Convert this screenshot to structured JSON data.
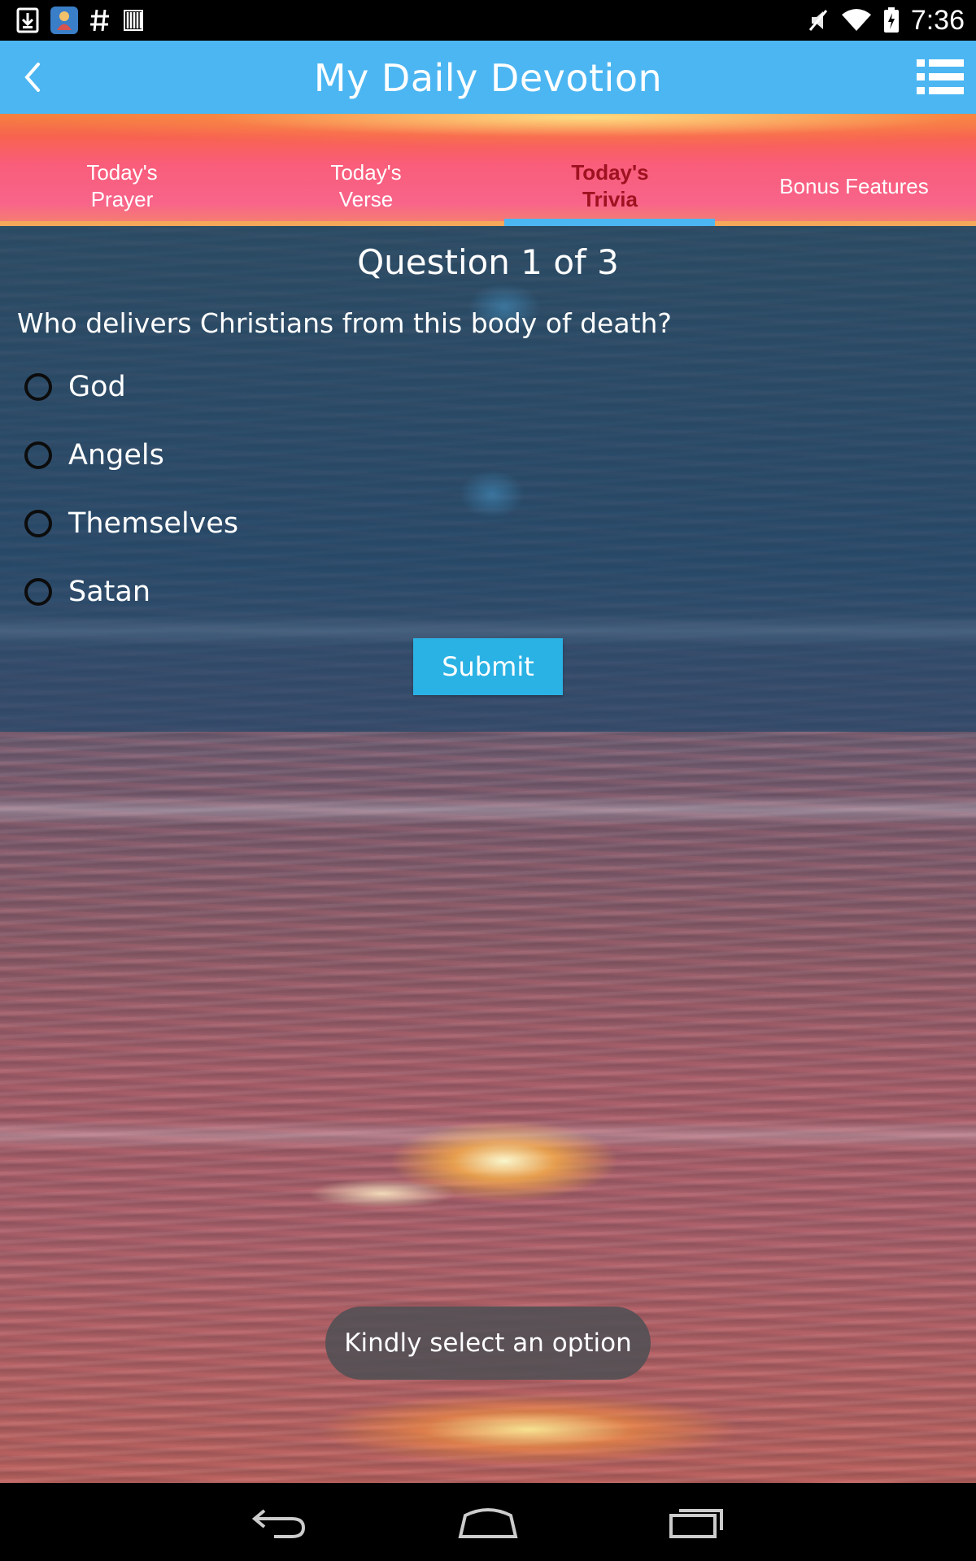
{
  "status_bar": {
    "time": "7:36",
    "left_icons": [
      "download-icon",
      "app-icon",
      "hashtag-icon",
      "barcode-icon"
    ],
    "right_icons": [
      "mute-icon",
      "wifi-icon",
      "battery-charging-icon"
    ]
  },
  "app_bar": {
    "title": "My Daily Devotion",
    "background_color": "#4cb6f2",
    "left_icon": "back-chevron-icon",
    "right_icon": "list-menu-icon"
  },
  "tabs": [
    {
      "label": "Today's\nPrayer",
      "active": false
    },
    {
      "label": "Today's\nVerse",
      "active": false
    },
    {
      "label": "Today's\nTrivia",
      "active": true
    },
    {
      "label": "Bonus Features",
      "active": false
    }
  ],
  "tab_colors": {
    "active_text": "#9e1220",
    "indicator": "#4cb6f2"
  },
  "quiz": {
    "counter": "Question 1 of 3",
    "question": "Who delivers Christians from this body of death?",
    "options": [
      "God",
      "Angels",
      "Themselves",
      "Satan"
    ],
    "selected": null,
    "submit_label": "Submit",
    "submit_color": "#2bb2e4"
  },
  "toast": {
    "message": "Kindly select an option"
  },
  "nav_bar": {
    "buttons": [
      "back-icon",
      "home-icon",
      "recents-icon"
    ]
  }
}
